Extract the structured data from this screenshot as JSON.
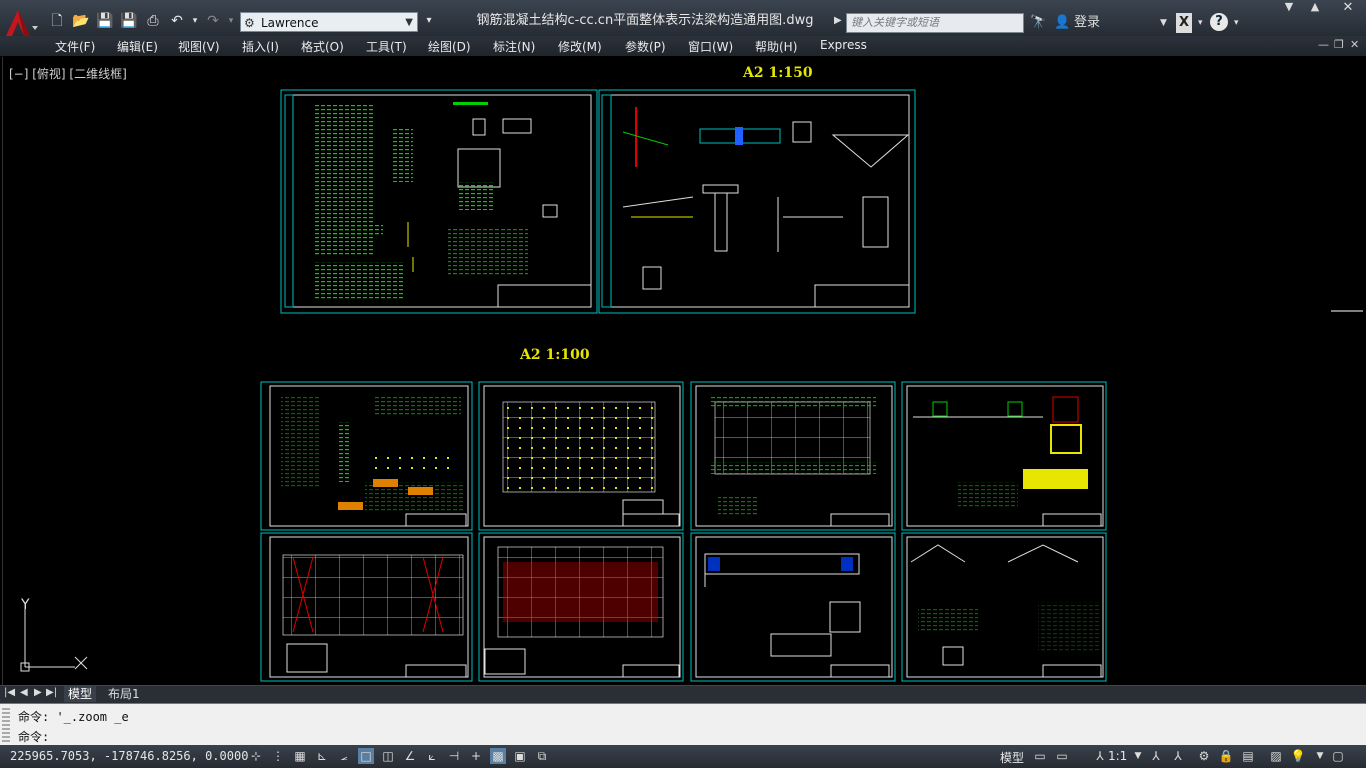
{
  "titlebar": {
    "workspace": "Lawrence",
    "document_title": "钢筋混凝土结构c-cc.cn平面整体表示法梁构造通用图.dwg",
    "search_placeholder": "键入关键字或短语",
    "login_label": "登录",
    "help_label": "?"
  },
  "menu": [
    "文件(F)",
    "编辑(E)",
    "视图(V)",
    "插入(I)",
    "格式(O)",
    "工具(T)",
    "绘图(D)",
    "标注(N)",
    "修改(M)",
    "参数(P)",
    "窗口(W)",
    "帮助(H)",
    "Express"
  ],
  "viewport": {
    "label": "[−] [俯视] [二维线框]",
    "scale_top": "A2  1:150",
    "scale_bottom": "A2  1:100",
    "ucs_y": "Y"
  },
  "layout_tabs": [
    "模型",
    "布局1"
  ],
  "command": {
    "history": "命令: '_.zoom _e",
    "prompt": "命令:"
  },
  "status": {
    "coordinates": "225965.7053, -178746.8256, 0.0000",
    "model_label": "模型",
    "annotation_scale": "1:1"
  },
  "colors": {
    "accent_cyan": "#00bfbf",
    "drawing_green": "#00e000",
    "drawing_yellow": "#e6e600",
    "drawing_red": "#e00000",
    "app_red": "#c4161c"
  }
}
